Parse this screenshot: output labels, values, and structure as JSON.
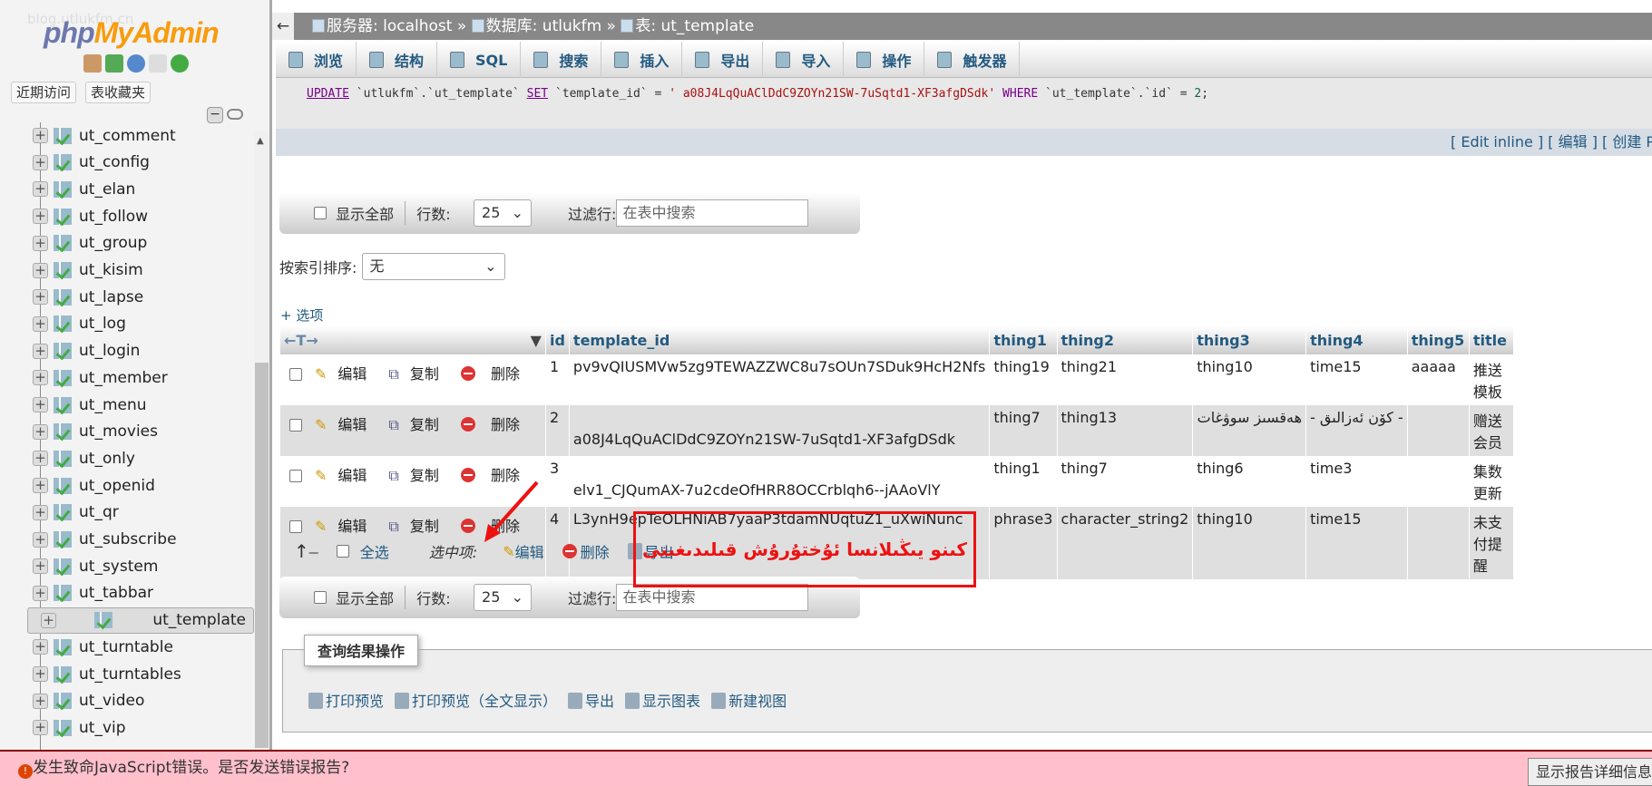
{
  "sidebar": {
    "logo_php": "php",
    "logo_myadmin": "MyAdmin",
    "watermark": "blog.utlukfm.cn",
    "recent_btn": "近期访问",
    "favorites_btn": "表收藏夹",
    "tables": [
      "ut_comment",
      "ut_config",
      "ut_elan",
      "ut_follow",
      "ut_group",
      "ut_kisim",
      "ut_lapse",
      "ut_log",
      "ut_login",
      "ut_member",
      "ut_menu",
      "ut_movies",
      "ut_only",
      "ut_openid",
      "ut_qr",
      "ut_subscribe",
      "ut_system",
      "ut_tabbar",
      "ut_template",
      "ut_turntable",
      "ut_turntables",
      "ut_video",
      "ut_vip"
    ],
    "selected": "ut_template"
  },
  "breadcrumb": {
    "server": "服务器: localhost",
    "sep": "»",
    "database": "数据库: utlukfm",
    "table": "表: ut_template"
  },
  "tabs": [
    "浏览",
    "结构",
    "SQL",
    "搜索",
    "插入",
    "导出",
    "导入",
    "操作",
    "触发器"
  ],
  "sql": {
    "kw1": "UPDATE",
    "p1": " `utlukfm`.`ut_template` ",
    "kw2": "SET",
    "p2": " `template_id` = ",
    "str": "' a08J4LqQuAClDdC9ZOYn21SW-7uSqtd1-XF3afgDSdk'",
    "kw3": " WHERE",
    "p3": " `ut_template`.`id` = ",
    "num": "2",
    "end": ";"
  },
  "sql_links": "[ Edit inline ] [ 编辑 ] [ 创建 PHP 代码 ]",
  "nav": {
    "show_all": "显示全部",
    "rows_label": "行数:",
    "rows_value": "25",
    "filter_label": "过滤行:",
    "filter_placeholder": "在表中搜索"
  },
  "sort": {
    "label": "按索引排序:",
    "value": "无"
  },
  "options_link": "+ 选项",
  "table": {
    "headers": [
      "id",
      "template_id",
      "thing1",
      "thing2",
      "thing3",
      "thing4",
      "thing5",
      "title"
    ],
    "actions": {
      "edit": "编辑",
      "copy": "复制",
      "delete": "删除"
    },
    "rows": [
      [
        "1",
        "pv9vQIUSMVw5zg9TEWAZZWC8u7sOUn7SDuk9HcH2Nfs",
        "thing19",
        "thing21",
        "thing10",
        "time15",
        "aaaaa",
        "推送模板"
      ],
      [
        "2",
        "a08J4LqQuAClDdC9ZOYn21SW-7uSqtd1-XF3afgDSdk",
        "thing7",
        "thing13",
        "ھەقسىز سوۋغات",
        "- كۆن ئەزالىق -",
        "",
        "赠送会员"
      ],
      [
        "3",
        "elv1_CJQumAX-7u2cdeOfHRR8OCCrblqh6--jAAoVlY",
        "thing1",
        "thing7",
        "thing6",
        "time3",
        "",
        "集数更新"
      ],
      [
        "4",
        "L3ynH9epTeOLHNiAB7yaaP3tdamNUqtuZ1_uXwiNunc",
        "phrase3",
        "character_string2",
        "thing10",
        "time15",
        "",
        "未支付提醒"
      ]
    ]
  },
  "bulk": {
    "select_all": "全选",
    "with_selected": "选中项:",
    "edit": "编辑",
    "delete": "删除",
    "export": "导出"
  },
  "query_ops": {
    "legend": "查询结果操作",
    "items": [
      "打印预览",
      "打印预览（全文显示）",
      "导出",
      "显示图表",
      "新建视图"
    ]
  },
  "annotation": "كىنو يىڭىلانسا ئۇختۇرۇش قىلىدىغىنى",
  "annotation_color": "#e11111",
  "error": {
    "message": "发生致命JavaScript错误。是否发送错误报告?",
    "button": "显示报告详细信息"
  }
}
